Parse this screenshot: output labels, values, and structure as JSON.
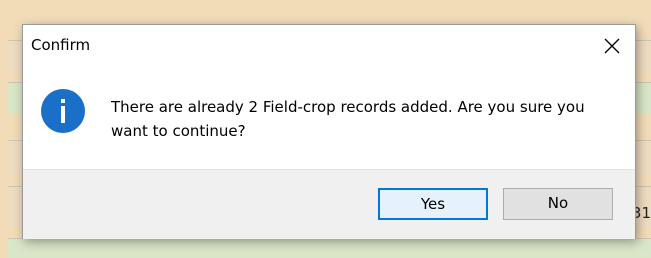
{
  "dialog": {
    "title": "Confirm",
    "message": "There are already 2 Field-crop records added. Are you sure you want to continue?",
    "icon": "info-icon",
    "buttons": {
      "yes": "Yes",
      "no": "No"
    }
  },
  "background": {
    "partial_text": "31"
  },
  "colors": {
    "accent": "#0078d7",
    "info_icon": "#1a6fc9",
    "footer": "#f0f0f0",
    "desktop": "#f2dcb8"
  }
}
